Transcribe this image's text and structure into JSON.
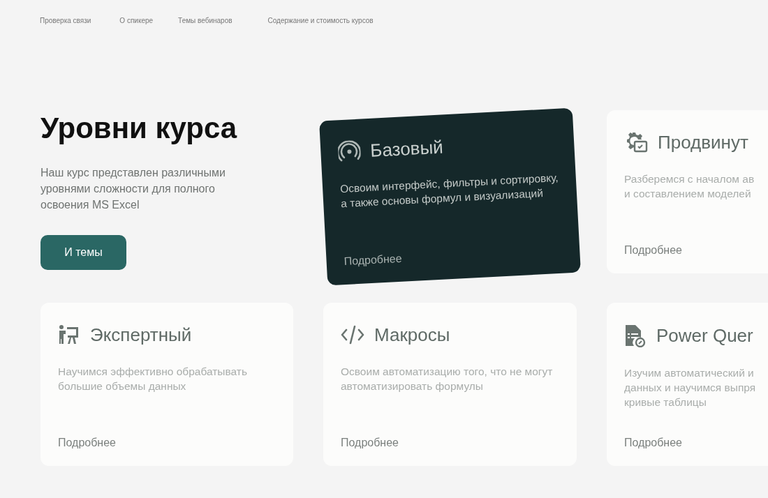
{
  "nav": [
    "Проверка связи",
    "О спикере",
    "Темы вебинаров",
    "Содержание и стоимость курсов"
  ],
  "hero": {
    "title": "Уровни курса",
    "text": "Наш курс представлен различными уровнями сложности для полного освоения MS Excel",
    "button": "И темы"
  },
  "cards": [
    {
      "title": "Базовый",
      "description": "Освоим интерфейс, фильтры и сортировку, а также основы формул и визуализаций",
      "link": "Подробнее",
      "selected": true
    },
    {
      "title": "Продвинут",
      "description": "Разберемся с началом ав\nи составлением моделей",
      "link": "Подробнее",
      "selected": false
    },
    {
      "title": "Экспертный",
      "description": "Научимся эффективно обрабатывать большие объемы данных",
      "link": "Подробнее",
      "selected": false
    },
    {
      "title": "Макросы",
      "description": "Освоим автоматизацию того, что не могут автоматизировать формулы",
      "link": "Подробнее",
      "selected": false
    },
    {
      "title": "Power Quer",
      "description": "Изучим автоматический и\nданных и научимся выпря\nкривые таблицы",
      "link": "Подробнее",
      "selected": false
    }
  ]
}
